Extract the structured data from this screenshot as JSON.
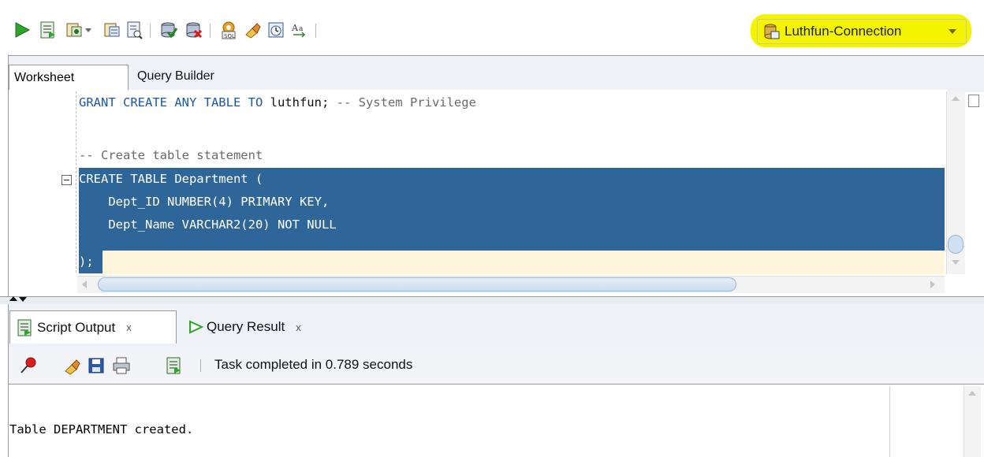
{
  "toolbar": {
    "buttons": [
      {
        "name": "run-statement",
        "icon": "run-icon"
      },
      {
        "name": "run-script",
        "icon": "run-script-icon"
      },
      {
        "name": "commit",
        "icon": "commit-icon"
      },
      {
        "name": "autotrace",
        "icon": "autotrace-icon"
      },
      {
        "name": "explain",
        "icon": "explain-plan-icon"
      },
      {
        "name": "commit-db",
        "icon": "database-commit-icon"
      },
      {
        "name": "rollback-db",
        "icon": "database-rollback-icon"
      },
      {
        "name": "sql-tuning",
        "icon": "sql-tuning-icon"
      },
      {
        "name": "clear",
        "icon": "eraser-icon"
      },
      {
        "name": "history",
        "icon": "sql-history-icon"
      },
      {
        "name": "format",
        "icon": "case-format-icon"
      }
    ],
    "connection": {
      "label": "Luthfun-Connection",
      "highlight_color": "#f4f400"
    }
  },
  "worksheet": {
    "tabs": [
      {
        "label": "Worksheet",
        "active": true
      },
      {
        "label": "Query Builder",
        "active": false
      }
    ],
    "code": {
      "line1_kw": "GRANT CREATE ANY TABLE TO",
      "line1_id": " luthfun;",
      "line1_cm": " -- System Privilege",
      "line2_cm": "-- Create table statement",
      "line3": "CREATE TABLE Department (",
      "line4": "    Dept_ID NUMBER(4) PRIMARY KEY,",
      "line5": "    Dept_Name VARCHAR2(20) NOT NULL",
      "line6": ");"
    },
    "selection_color": "#2f6699"
  },
  "output": {
    "tabs": [
      {
        "label": "Script Output",
        "close": "x",
        "active": true
      },
      {
        "label": "Query Result",
        "close": "x",
        "active": false
      }
    ],
    "status": "Task completed in 0.789 seconds",
    "text": "Table DEPARTMENT created."
  }
}
